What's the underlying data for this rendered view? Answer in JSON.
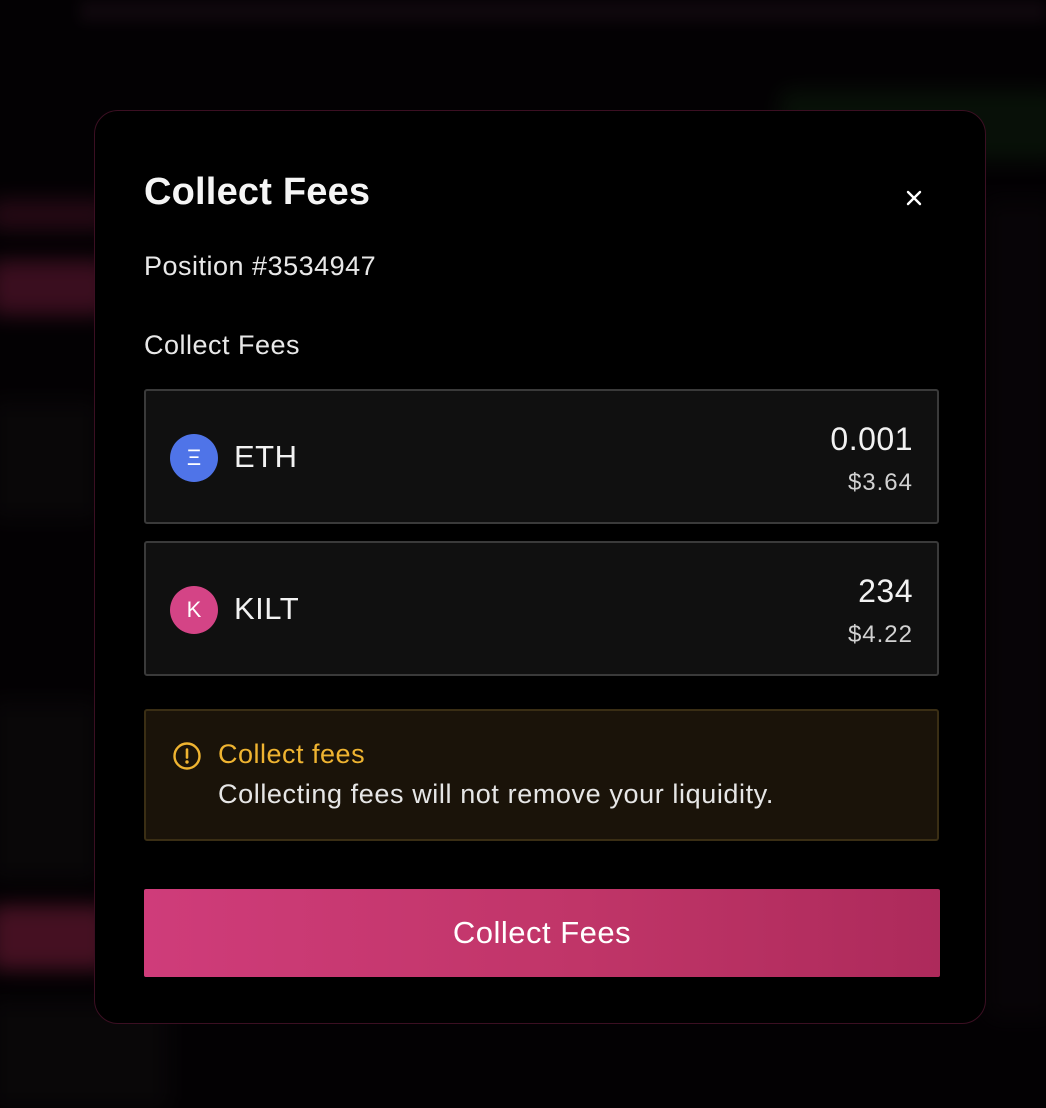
{
  "modal": {
    "title": "Collect Fees",
    "position_label": "Position #3534947",
    "section_label": "Collect Fees",
    "close_icon": "close-icon"
  },
  "tokens": [
    {
      "symbol": "ETH",
      "icon_glyph": "Ξ",
      "icon_color": "#4f74e8",
      "amount": "0.001",
      "usd_value": "$3.64"
    },
    {
      "symbol": "KILT",
      "icon_glyph": "K",
      "icon_color": "#d44486",
      "amount": "234",
      "usd_value": "$4.22"
    }
  ],
  "notice": {
    "icon": "info-circle-icon",
    "title": "Collect fees",
    "text": "Collecting fees will not remove your liquidity.",
    "accent_color": "#efb431"
  },
  "action": {
    "button_label": "Collect Fees",
    "button_color": "#c8387a"
  }
}
